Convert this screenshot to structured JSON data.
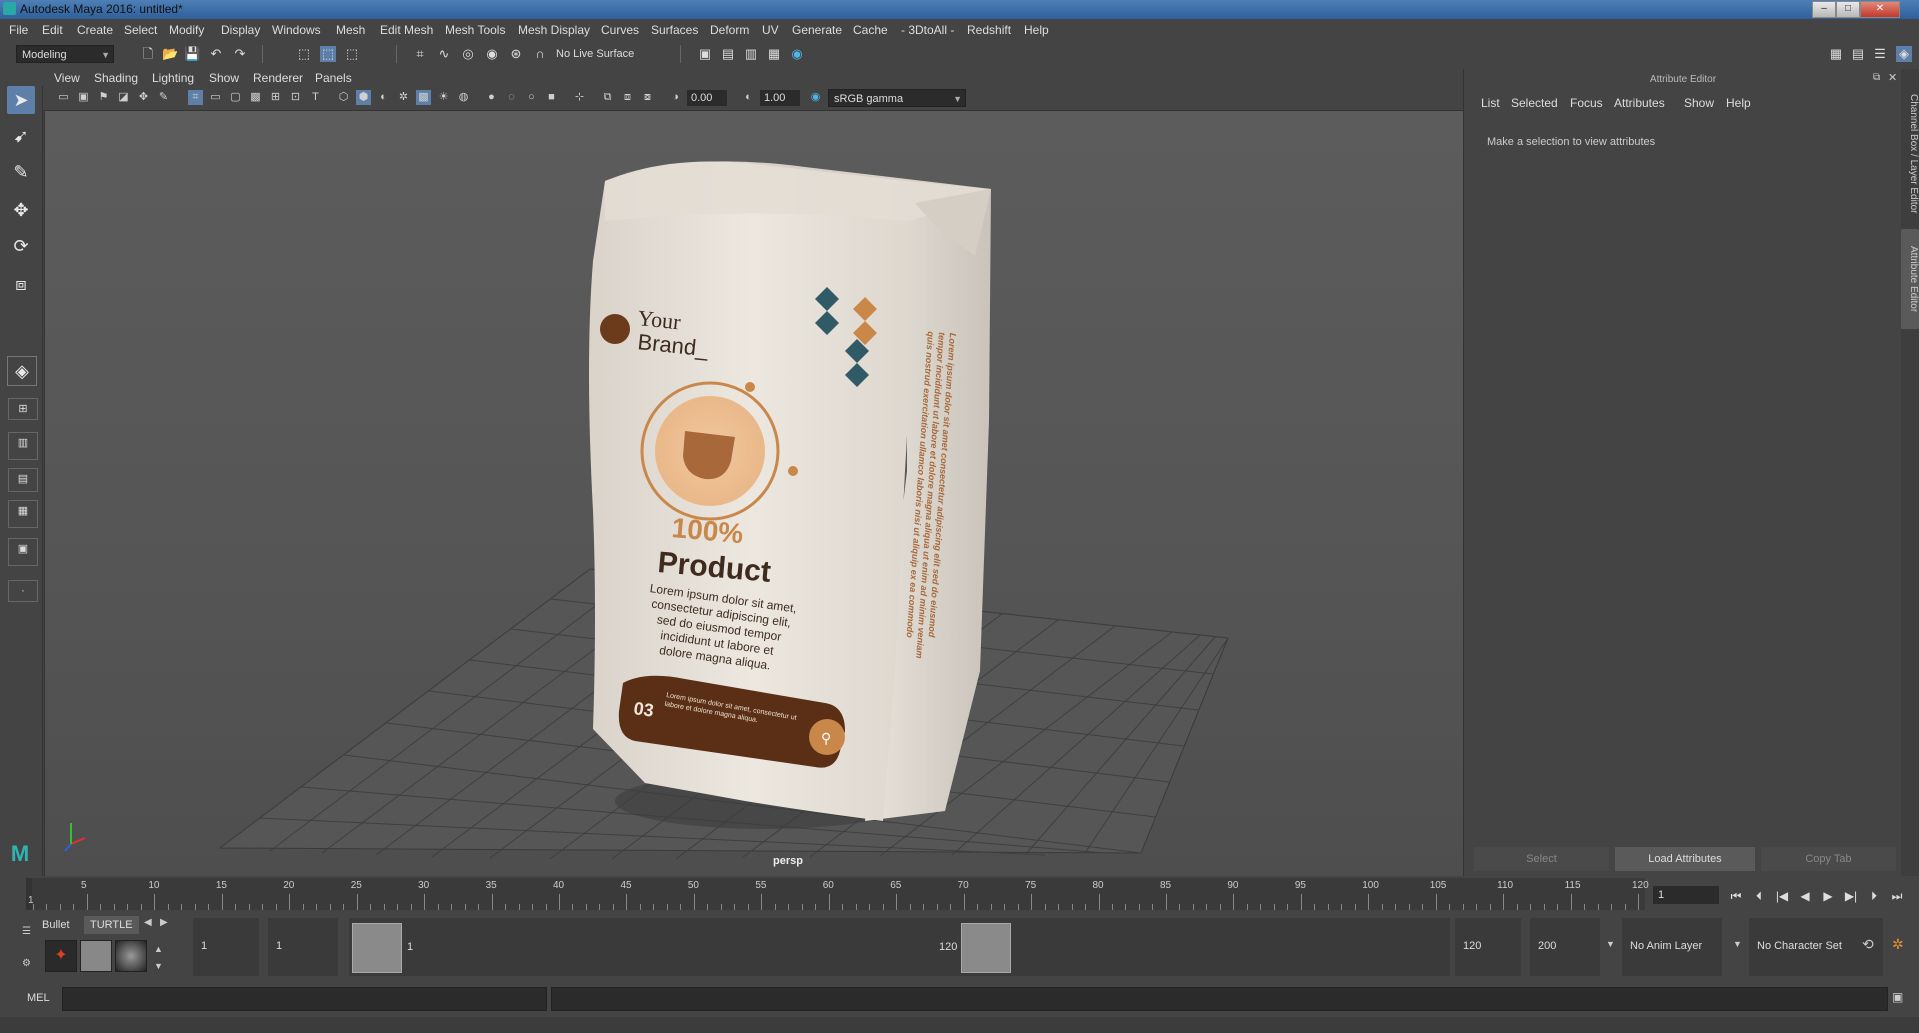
{
  "window": {
    "title": "Autodesk Maya 2016: untitled*",
    "minimize": "–",
    "maximize": "□",
    "close": "✕"
  },
  "menubar": {
    "items": [
      "File",
      "Edit",
      "Create",
      "Select",
      "Modify",
      "Display",
      "Windows",
      "Mesh",
      "Edit Mesh",
      "Mesh Tools",
      "Mesh Display",
      "Curves",
      "Surfaces",
      "Deform",
      "UV",
      "Generate",
      "Cache",
      "- 3DtoAll -",
      "Redshift",
      "Help"
    ]
  },
  "statusline": {
    "mode": "Modeling",
    "live_surface": "No Live Surface"
  },
  "viewport": {
    "menus": [
      "View",
      "Shading",
      "Lighting",
      "Show",
      "Renderer",
      "Panels"
    ],
    "exposure": "0.00",
    "gamma": "1.00",
    "colorspace": "sRGB gamma",
    "camera_label": "persp"
  },
  "product": {
    "brand_line1": "Your",
    "brand_line2": "Brand_",
    "headline_pct": "100%",
    "headline": "Product",
    "body": "Lorem ipsum dolor sit amet, consectetur adipiscing elit, sed do eiusmod tempor incididunt ut labore et dolore magna aliqua.",
    "badge_num": "03",
    "badge_text": "Lorem ipsum dolor sit amet, consectetur ut labore et dolore magna aliqua.",
    "side_text": "Lorem ipsum dolor sit amet consectetur adipiscing elit sed do eiusmod tempor incididunt ut labore et dolore magna aliqua ut enim ad minim veniam quis nostrud exercitation ullamco laboris nisi ut aliquip ex ea commodo"
  },
  "attribute_editor": {
    "title": "Attribute Editor",
    "menus": [
      "List",
      "Selected",
      "Focus",
      "Attributes",
      "Show",
      "Help"
    ],
    "message": "Make a selection to view attributes",
    "buttons": {
      "select": "Select",
      "load": "Load Attributes",
      "copy": "Copy Tab"
    },
    "side_tabs": [
      "Channel Box / Layer Editor",
      "Attribute Editor"
    ]
  },
  "timeslider": {
    "start_tick": "1",
    "ticks": [
      "5",
      "10",
      "15",
      "20",
      "25",
      "30",
      "35",
      "40",
      "45",
      "50",
      "55",
      "60",
      "65",
      "70",
      "75",
      "80",
      "85",
      "90",
      "95",
      "100",
      "105",
      "110",
      "115",
      "120"
    ],
    "current_frame": "1"
  },
  "rangeslider": {
    "shelf_tabs": [
      "Bullet",
      "TURTLE"
    ],
    "start_time": "1",
    "playback_start": "1",
    "range_start_label": "1",
    "range_end_label": "120",
    "playback_end": "120",
    "end_time": "200",
    "anim_layer": "No Anim Layer",
    "character_set": "No Character Set"
  },
  "commandline": {
    "label": "MEL"
  },
  "colors": {
    "accent": "#5d7fa8",
    "bag": "#e9e4dc",
    "bag_brown": "#6b3b1c",
    "bag_orange": "#c9874a",
    "bag_teal": "#2f5a66"
  }
}
